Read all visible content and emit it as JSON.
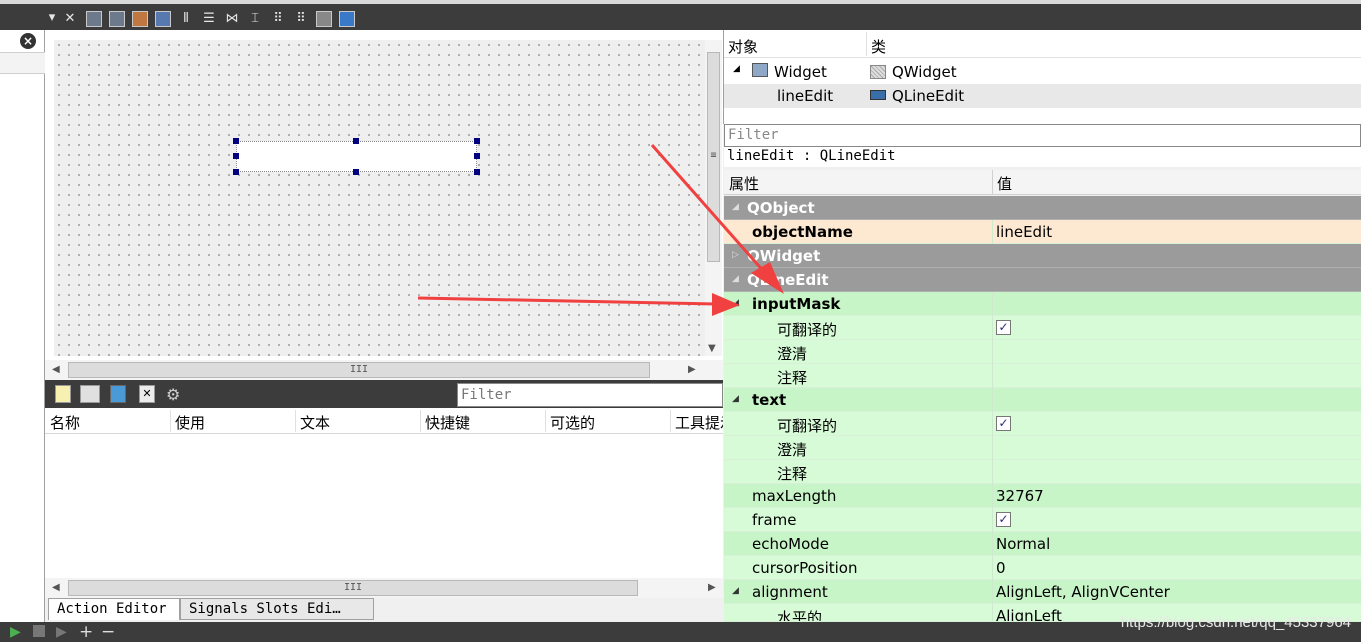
{
  "object_inspector": {
    "headers": [
      "对象",
      "类"
    ],
    "rows": [
      {
        "name": "Widget",
        "class": "QWidget"
      },
      {
        "name": "lineEdit",
        "class": "QLineEdit"
      }
    ]
  },
  "property_editor": {
    "filter_placeholder": "Filter",
    "object_path": "lineEdit : QLineEdit",
    "headers": [
      "属性",
      "值"
    ],
    "categories": {
      "qobject": "QObject",
      "qwidget": "QWidget",
      "qlineedit": "QLineEdit"
    },
    "object_name": {
      "label": "objectName",
      "value": "lineEdit"
    },
    "input_mask": {
      "label": "inputMask",
      "translatable": "可翻译的",
      "disambiguation": "澄清",
      "comment": "注释"
    },
    "text": {
      "label": "text",
      "translatable": "可翻译的",
      "disambiguation": "澄清",
      "comment": "注释"
    },
    "max_length": {
      "label": "maxLength",
      "value": "32767"
    },
    "frame": {
      "label": "frame"
    },
    "echo_mode": {
      "label": "echoMode",
      "value": "Normal"
    },
    "cursor_position": {
      "label": "cursorPosition",
      "value": "0"
    },
    "alignment": {
      "label": "alignment",
      "value": "AlignLeft, AlignVCenter"
    },
    "horizontal": {
      "label": "水平的",
      "value": "AlignLeft"
    }
  },
  "action_editor": {
    "filter_placeholder": "Filter",
    "headers": [
      "名称",
      "使用",
      "文本",
      "快捷键",
      "可选的",
      "工具提示"
    ]
  },
  "bottom_tabs": {
    "action_editor": "Action Editor",
    "signals_slots": "Signals  Slots Edi…"
  },
  "canvas": {
    "scroll_grip": "III",
    "vscroll_grip": "≡"
  },
  "watermark": "https://blog.csdn.net/qq_45337964",
  "colors": {
    "category": "#9b9b9b",
    "green_row": "#c8f5c8",
    "peach_row": "#fde8d2",
    "annotation_arrow": "#f04040"
  }
}
